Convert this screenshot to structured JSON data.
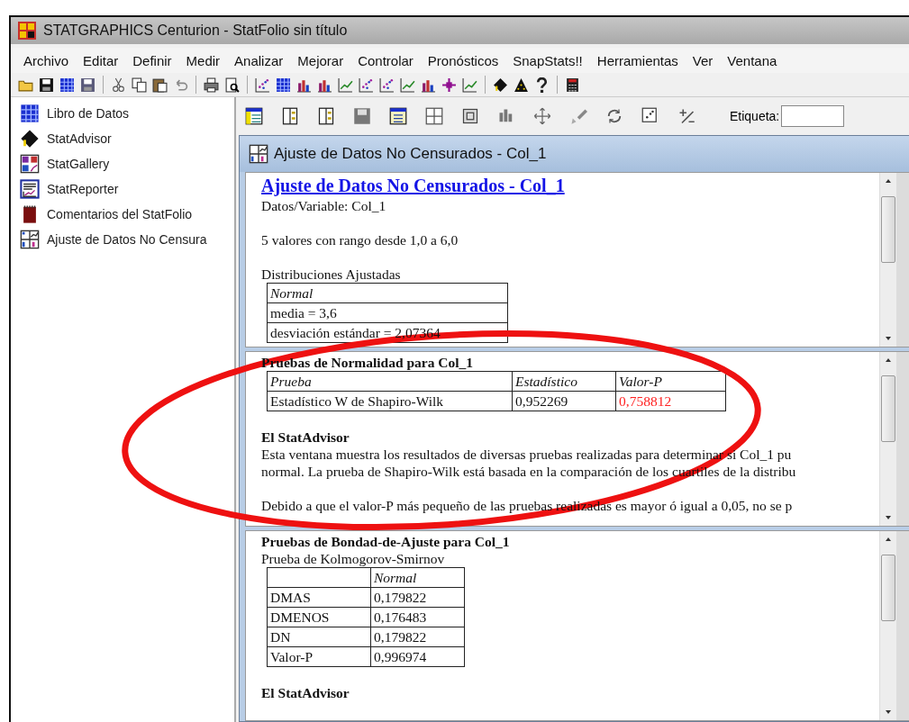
{
  "window": {
    "title": "STATGRAPHICS Centurion - StatFolio sin título"
  },
  "menu": [
    "Archivo",
    "Editar",
    "Definir",
    "Medir",
    "Analizar",
    "Mejorar",
    "Controlar",
    "Pronósticos",
    "SnapStats!!",
    "Herramientas",
    "Ver",
    "Ventana"
  ],
  "sidebar": {
    "items": [
      {
        "label": "Libro de Datos"
      },
      {
        "label": "StatAdvisor"
      },
      {
        "label": "StatGallery"
      },
      {
        "label": "StatReporter"
      },
      {
        "label": "Comentarios del StatFolio"
      },
      {
        "label": "Ajuste de Datos No Censura"
      }
    ]
  },
  "toolbar": {
    "field_label": "Etiqueta:"
  },
  "child_window": {
    "title": "Ajuste de Datos No Censurados - Col_1"
  },
  "panes": [
    {
      "blocks": [
        {
          "kind": "title",
          "text": "Ajuste de Datos No Censurados - Col_1"
        },
        {
          "kind": "text",
          "lines": [
            "Datos/Variable: Col_1"
          ]
        },
        {
          "kind": "text",
          "lines": [
            "5 valores con rango desde 1,0 a 6,0"
          ]
        },
        {
          "kind": "text",
          "lines": [
            "Distribuciones Ajustadas"
          ]
        },
        {
          "kind": "table",
          "header": [
            "Normal"
          ],
          "rows": [
            [
              "media = 3,6"
            ],
            [
              "desviación estándar = 2,07364"
            ]
          ]
        }
      ]
    },
    {
      "blocks": [
        {
          "kind": "subhead",
          "text": "Pruebas de Normalidad para Col_1"
        },
        {
          "kind": "table",
          "header": [
            "Prueba",
            "Estadístico",
            "Valor-P"
          ],
          "rows": [
            [
              {
                "text": "Estadístico W de Shapiro-Wilk",
                "highlight": false
              },
              {
                "text": "0,952269",
                "highlight": false
              },
              {
                "text": "0,758812",
                "highlight": true
              }
            ]
          ]
        },
        {
          "kind": "subhead",
          "text": "El StatAdvisor"
        },
        {
          "kind": "text",
          "lines": [
            "Esta ventana muestra los resultados de diversas pruebas realizadas para determinar si Col_1 pu",
            "normal.  La prueba de Shapiro-Wilk está basada en la comparación de los cuartiles de la distribu"
          ]
        },
        {
          "kind": "text",
          "lines": [
            "Debido a que el valor-P más pequeño de las pruebas realizadas es mayor ó igual a 0,05, no se p"
          ]
        }
      ]
    },
    {
      "blocks": [
        {
          "kind": "subhead",
          "text": "Pruebas de Bondad-de-Ajuste para Col_1"
        },
        {
          "kind": "text",
          "lines": [
            "Prueba de Kolmogorov-Smirnov"
          ]
        },
        {
          "kind": "table",
          "blank_corner": true,
          "header": [
            "Normal"
          ],
          "rows": [
            [
              "DMAS",
              "0,179822"
            ],
            [
              "DMENOS",
              "0,176483"
            ],
            [
              "DN",
              "0,179822"
            ],
            [
              "Valor-P",
              "0,996974"
            ]
          ]
        },
        {
          "kind": "subhead",
          "text": "El StatAdvisor"
        }
      ]
    }
  ]
}
